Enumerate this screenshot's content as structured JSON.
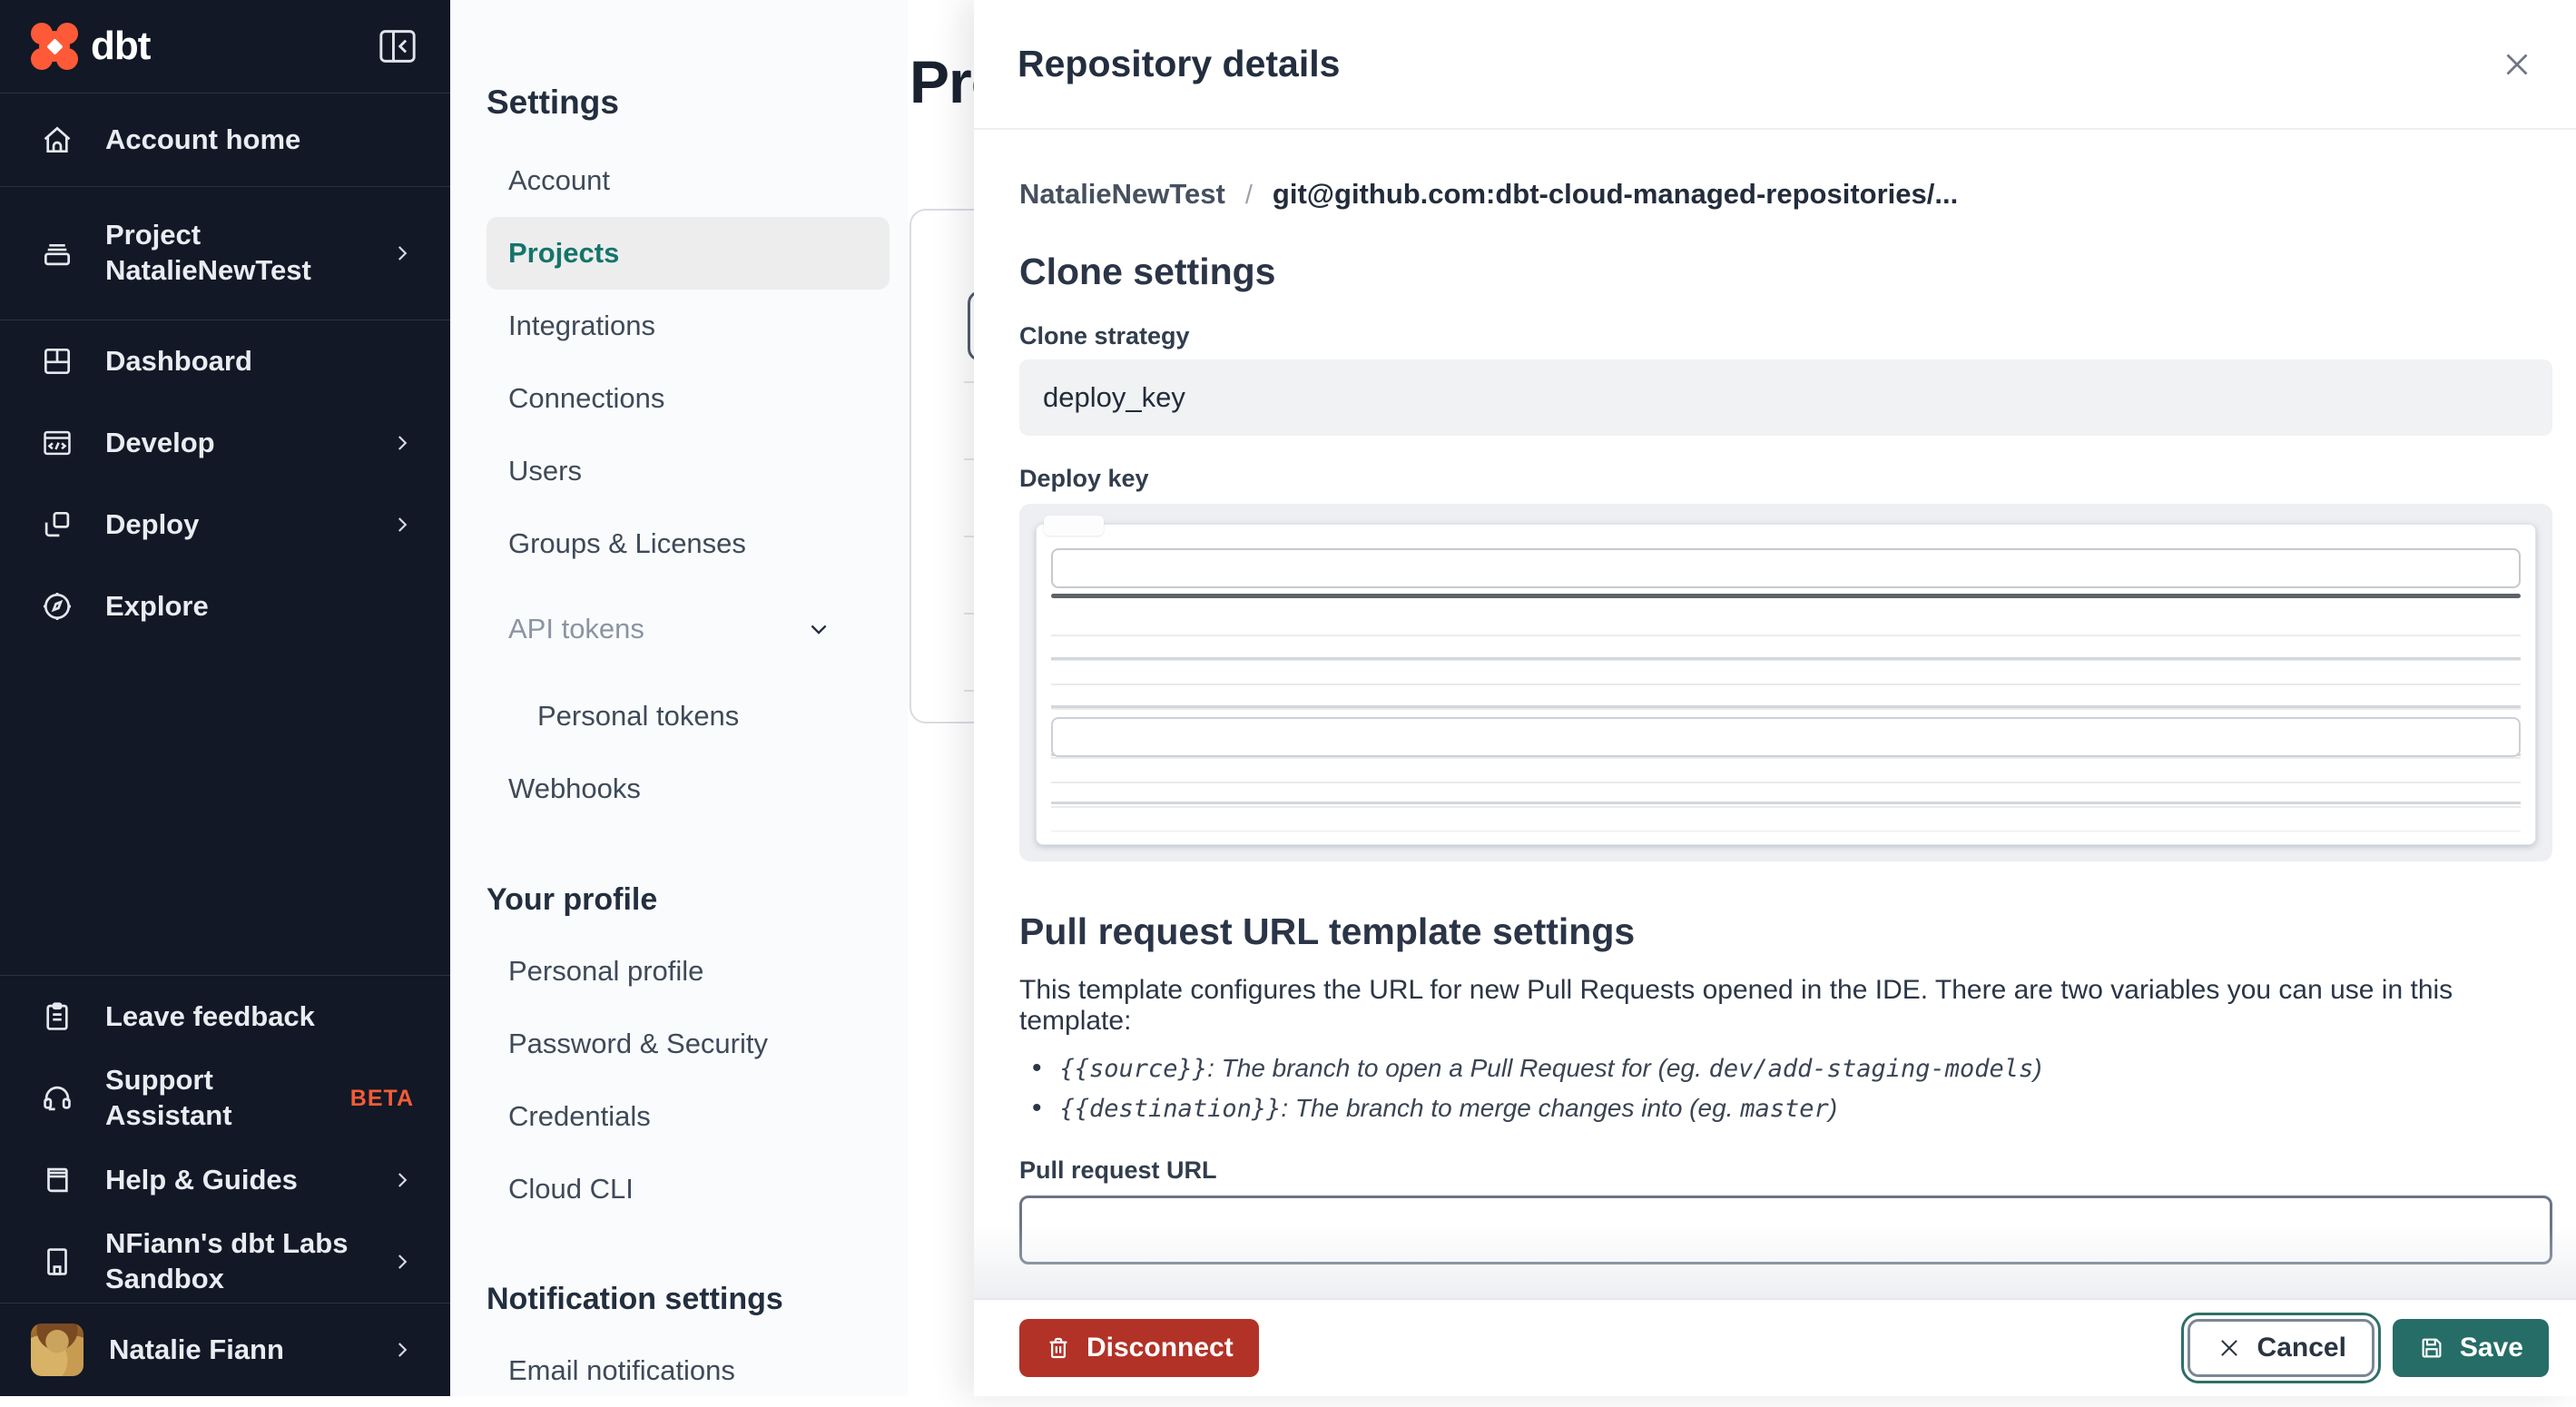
{
  "sidebar": {
    "logo_text": "dbt",
    "account_home": "Account home",
    "project_line1": "Project",
    "project_line2": "NatalieNewTest",
    "dashboard": "Dashboard",
    "develop": "Develop",
    "deploy": "Deploy",
    "explore": "Explore",
    "leave_feedback": "Leave feedback",
    "support_assistant": "Support Assistant",
    "beta_badge": "BETA",
    "help_guides": "Help & Guides",
    "sandbox": "NFiann's dbt Labs Sandbox",
    "user_name": "Natalie Fiann"
  },
  "settings_nav": {
    "heading": "Settings",
    "account": "Account",
    "projects": "Projects",
    "integrations": "Integrations",
    "connections": "Connections",
    "users": "Users",
    "groups_licenses": "Groups & Licenses",
    "api_tokens": "API tokens",
    "personal_tokens": "Personal tokens",
    "webhooks": "Webhooks",
    "your_profile_heading": "Your profile",
    "personal_profile": "Personal profile",
    "password_security": "Password & Security",
    "credentials": "Credentials",
    "cloud_cli": "Cloud CLI",
    "notification_heading": "Notification settings",
    "email_notifications": "Email notifications"
  },
  "background": {
    "page_title": "Projects"
  },
  "panel": {
    "title": "Repository details",
    "breadcrumb": {
      "project": "NatalieNewTest",
      "separator": "/",
      "repo": "git@github.com:dbt-cloud-managed-repositories/..."
    },
    "clone": {
      "heading": "Clone settings",
      "strategy_label": "Clone strategy",
      "strategy_value": "deploy_key",
      "deploy_key_label": "Deploy key"
    },
    "pr": {
      "heading": "Pull request URL template settings",
      "description": "This template configures the URL for new Pull Requests opened in the IDE. There are two variables you can use in this template:",
      "bullets": [
        {
          "var": "{{source}}",
          "desc": ": The branch to open a Pull Request for (eg. ",
          "example": "dev/add-staging-models",
          "suffix": ")"
        },
        {
          "var": "{{destination}}",
          "desc": ": The branch to merge changes into (eg. ",
          "example": "master",
          "suffix": ")"
        }
      ],
      "url_label": "Pull request URL",
      "url_value": ""
    },
    "footer": {
      "disconnect": "Disconnect",
      "cancel": "Cancel",
      "save": "Save"
    }
  },
  "colors": {
    "brand_orange": "#ff5a37",
    "beta_orange": "#f55c35",
    "accent_teal": "#266d67",
    "danger_red": "#b23227",
    "sidebar_bg": "#121826"
  }
}
